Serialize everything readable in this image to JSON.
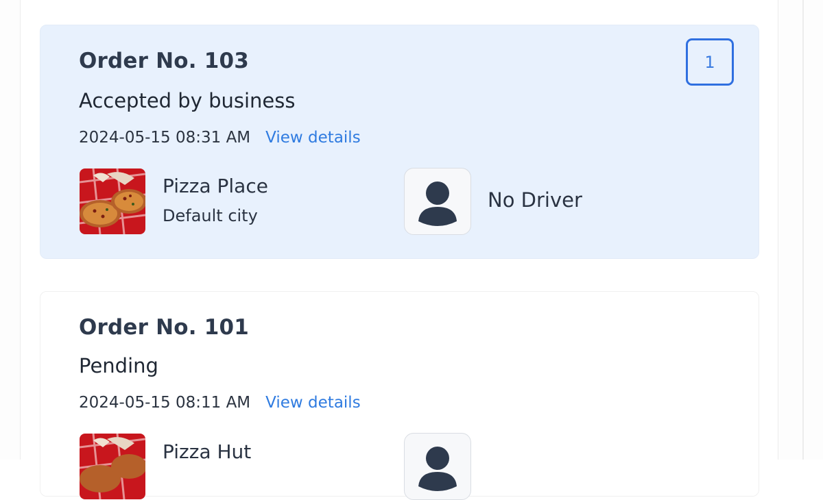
{
  "orders": [
    {
      "title": "Order No. 103",
      "status": "Accepted by business",
      "datetime": "2024-05-15 08:31 AM",
      "view_details": "View details",
      "business": {
        "name": "Pizza Place",
        "city": "Default city",
        "image_icon": "pizza-photo"
      },
      "driver": {
        "name": "No Driver",
        "avatar_icon": "user-silhouette-icon"
      },
      "badge_count": "1",
      "selected": true
    },
    {
      "title": "Order No. 101",
      "status": "Pending",
      "datetime": "2024-05-15 08:11 AM",
      "view_details": "View details",
      "business": {
        "name": "Pizza Hut",
        "image_icon": "pizza-photo"
      },
      "driver": {
        "avatar_icon": "user-silhouette-icon"
      },
      "selected": false
    }
  ],
  "colors": {
    "selected_card_bg": "#e8f1fd",
    "link": "#2f7be0",
    "badge_border": "#2f6fe0",
    "title_text": "#2e3a4d"
  }
}
